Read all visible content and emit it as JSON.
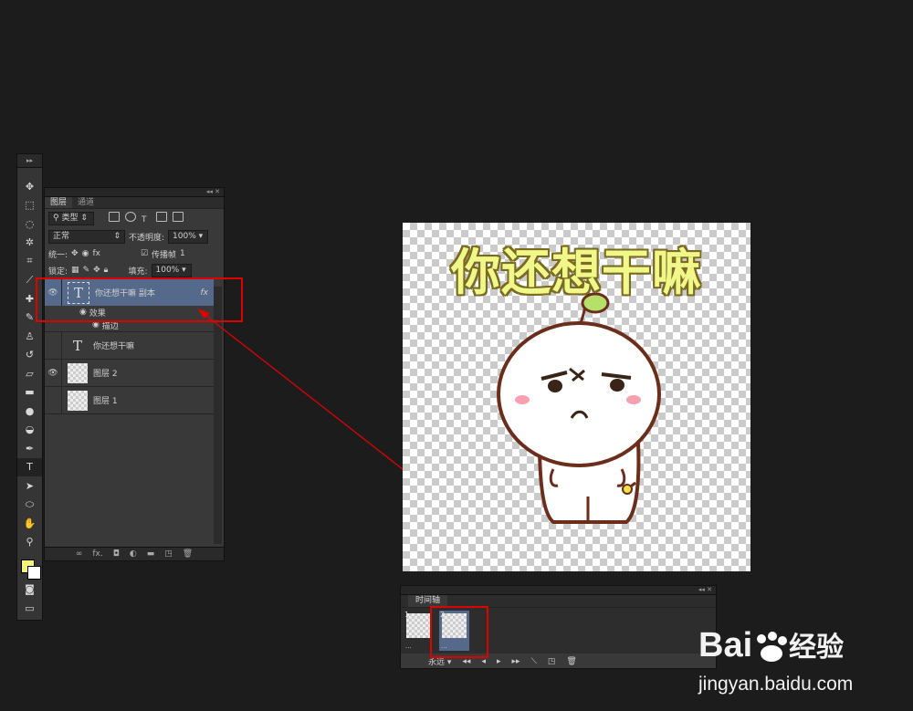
{
  "layers_panel": {
    "tabs": [
      "图层",
      "通道"
    ],
    "filter_kind": "类型",
    "blend_mode": "正常",
    "opacity_label": "不透明度:",
    "opacity_value": "100%",
    "unify_label": "统一:",
    "propagate_label": "传播帧",
    "propagate_value": "1",
    "lock_label": "锁定:",
    "fill_label": "填充:",
    "fill_value": "100%",
    "layers": [
      {
        "name": "你还想干嘛 副本",
        "type": "text",
        "visible": true,
        "fx": "fx",
        "selected": true
      },
      {
        "name": "你还想干嘛",
        "type": "text",
        "visible": false
      },
      {
        "name": "图层 2",
        "type": "image",
        "visible": true
      },
      {
        "name": "图层 1",
        "type": "image",
        "visible": false
      }
    ],
    "effects_label": "效果",
    "stroke_label": "描边"
  },
  "canvas": {
    "text": "你还想干嘛"
  },
  "timeline_panel": {
    "tab": "时间轴",
    "frames": [
      {
        "number": "1",
        "delay": "..."
      },
      {
        "number": "2",
        "delay": "..."
      }
    ],
    "loop_option": "永远"
  },
  "watermark": {
    "brand": "Bai",
    "brand2": "经验",
    "url": "jingyan.baidu.com"
  },
  "colors": {
    "foreground": "#f5f57a",
    "background": "#ffffff",
    "highlight_box": "#e00000",
    "selected_layer": "#556a8a"
  }
}
